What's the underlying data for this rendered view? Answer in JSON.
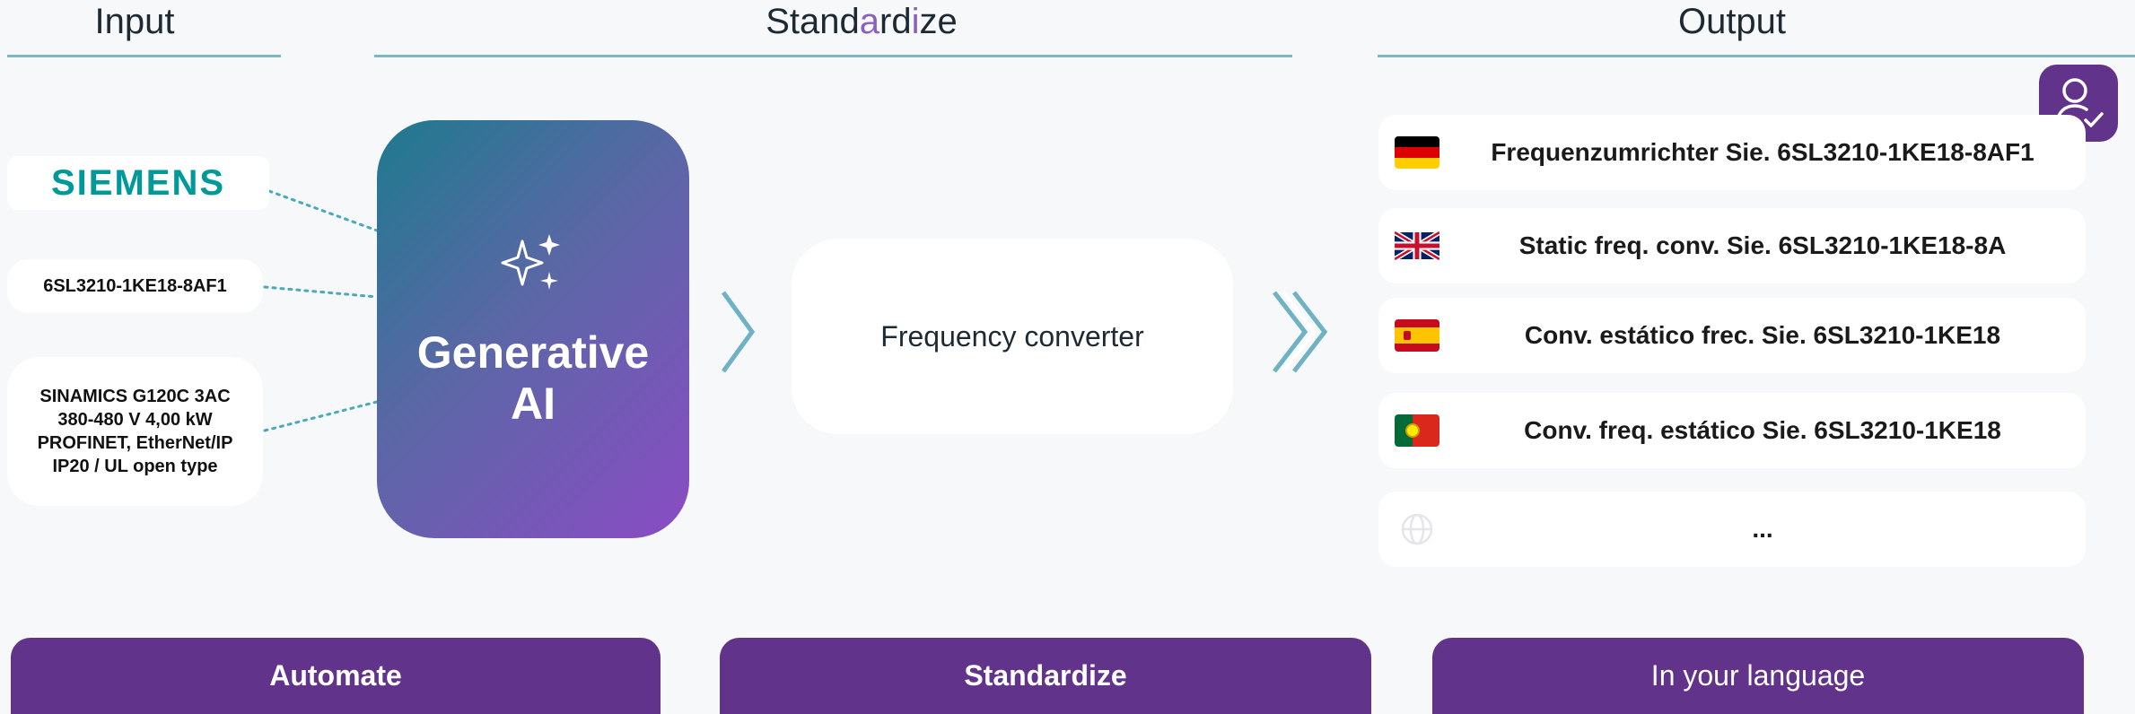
{
  "headers": {
    "input": "Input",
    "standardize_parts": [
      "Stand",
      "a",
      "rd",
      "i",
      "ze"
    ],
    "output": "Output"
  },
  "inputs": {
    "brand": "SIEMENS",
    "part_number": "6SL3210-1KE18-8AF1",
    "description": "SINAMICS G120C 3AC 380-480 V 4,00 kW PROFINET, EtherNet/IP IP20 / UL open type"
  },
  "generative_ai": {
    "title_line1": "Generative",
    "title_line2": "AI",
    "icon": "sparkles-icon"
  },
  "standardized": {
    "value": "Frequency converter"
  },
  "outputs": [
    {
      "flag": "flag-germany-icon",
      "text": "Frequenzumrichter Sie. 6SL3210-1KE18-8AF1"
    },
    {
      "flag": "flag-uk-icon",
      "text": "Static freq. conv. Sie. 6SL3210-1KE18-8A"
    },
    {
      "flag": "flag-spain-icon",
      "text": "Conv. estático frec. Sie. 6SL3210-1KE18"
    },
    {
      "flag": "flag-portugal-icon",
      "text": "Conv. freq. estático Sie. 6SL3210-1KE18"
    },
    {
      "flag": "globe-icon",
      "text": "..."
    }
  ],
  "buttons": {
    "automate": "Automate",
    "standardize": "Standardize",
    "language": "In your language"
  },
  "colors": {
    "accent_purple": "#61338a",
    "rule_teal": "#7fb6c4",
    "siemens_teal": "#009999",
    "gradient_start": "#1e7a8e",
    "gradient_end": "#8a4cc4"
  }
}
